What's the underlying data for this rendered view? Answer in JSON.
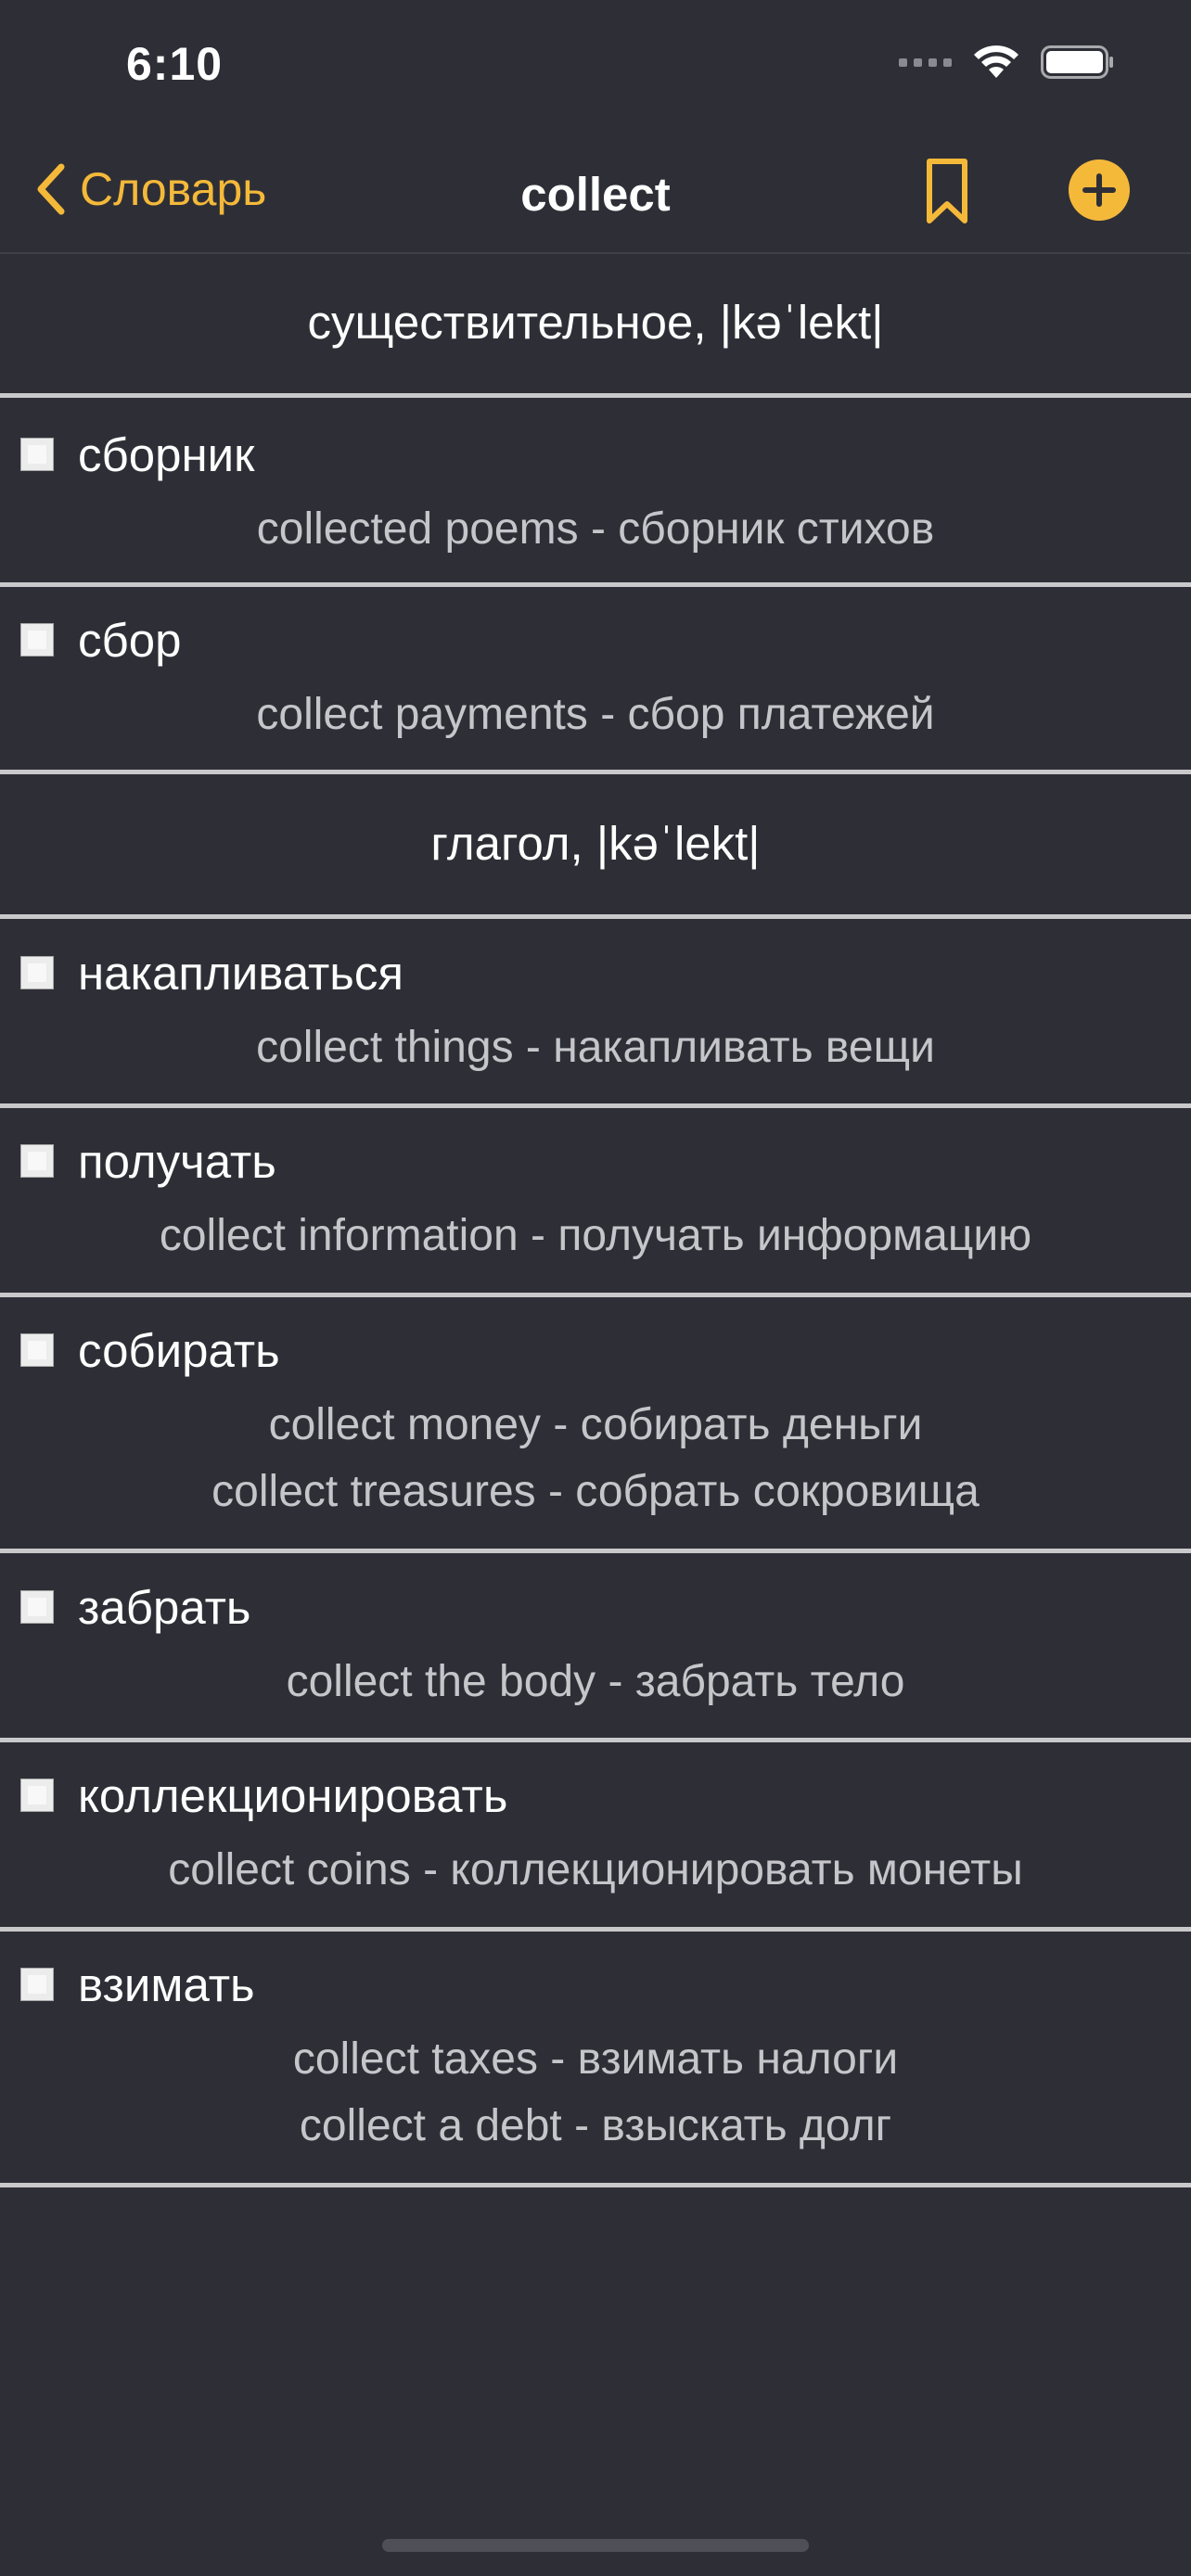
{
  "status_bar": {
    "time": "6:10"
  },
  "nav": {
    "back_label": "Словарь",
    "title": "collect",
    "accent_color": "#f5b93a",
    "icons": [
      "chevron-left-icon",
      "bookmark-icon",
      "plus-circle-icon"
    ]
  },
  "sections": [
    {
      "header": "существительное, |kəˈlekt|",
      "entries": [
        {
          "word": "сборник",
          "examples": [
            "collected poems - сборник стихов"
          ]
        },
        {
          "word": "сбор",
          "examples": [
            "collect payments - сбор платежей"
          ]
        }
      ]
    },
    {
      "header": "глагол, |kəˈlekt|",
      "entries": [
        {
          "word": "накапливаться",
          "examples": [
            "collect things - накапливать вещи"
          ]
        },
        {
          "word": "получать",
          "examples": [
            "collect information - получать информацию"
          ]
        },
        {
          "word": "собирать",
          "examples": [
            "collect money - собирать деньги",
            "collect treasures - собрать сокровища"
          ]
        },
        {
          "word": "забрать",
          "examples": [
            "collect the body - забрать тело"
          ]
        },
        {
          "word": "коллекционировать",
          "examples": [
            "collect coins - коллекционировать монеты"
          ]
        },
        {
          "word": "взимать",
          "examples": [
            "collect taxes - взимать налоги",
            "collect a debt - взыскать долг"
          ]
        }
      ]
    }
  ]
}
